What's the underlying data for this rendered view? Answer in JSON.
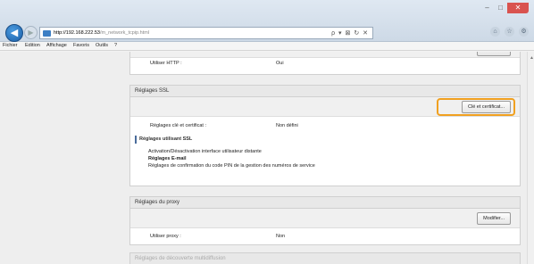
{
  "window": {
    "controls": {
      "minimize": "–",
      "maximize": "□",
      "close": "✕"
    }
  },
  "browser": {
    "url_host": "http://192.168.222.53",
    "url_path": "/m_network_tcpip.html",
    "address_tools": "ρ ▾ ⊠ ↻ ✕",
    "icons": [
      "home-icon",
      "star-icon",
      "gear-icon"
    ]
  },
  "menu": [
    "Fichier",
    "Edition",
    "Affichage",
    "Favoris",
    "Outils",
    "?"
  ],
  "sections": {
    "http": {
      "label": "Utiliser HTTP :",
      "value": "Oui"
    },
    "ssl": {
      "title": "Réglages SSL",
      "button": "Clé et certificat...",
      "key_label": "Réglages clé et certificat :",
      "key_value": "Non défini",
      "sub_title": "Réglages utilisant SSL",
      "items": [
        "Activation/Désactivation interface utilisateur distante",
        "Réglages E-mail",
        "Réglages de confirmation du code PIN de la gestion des numéros de service"
      ]
    },
    "proxy": {
      "title": "Réglages du proxy",
      "button": "Modifier...",
      "label": "Utiliser proxy :",
      "value": "Non"
    },
    "multicast": {
      "title": "Réglages de découverte multidiffusion"
    }
  }
}
